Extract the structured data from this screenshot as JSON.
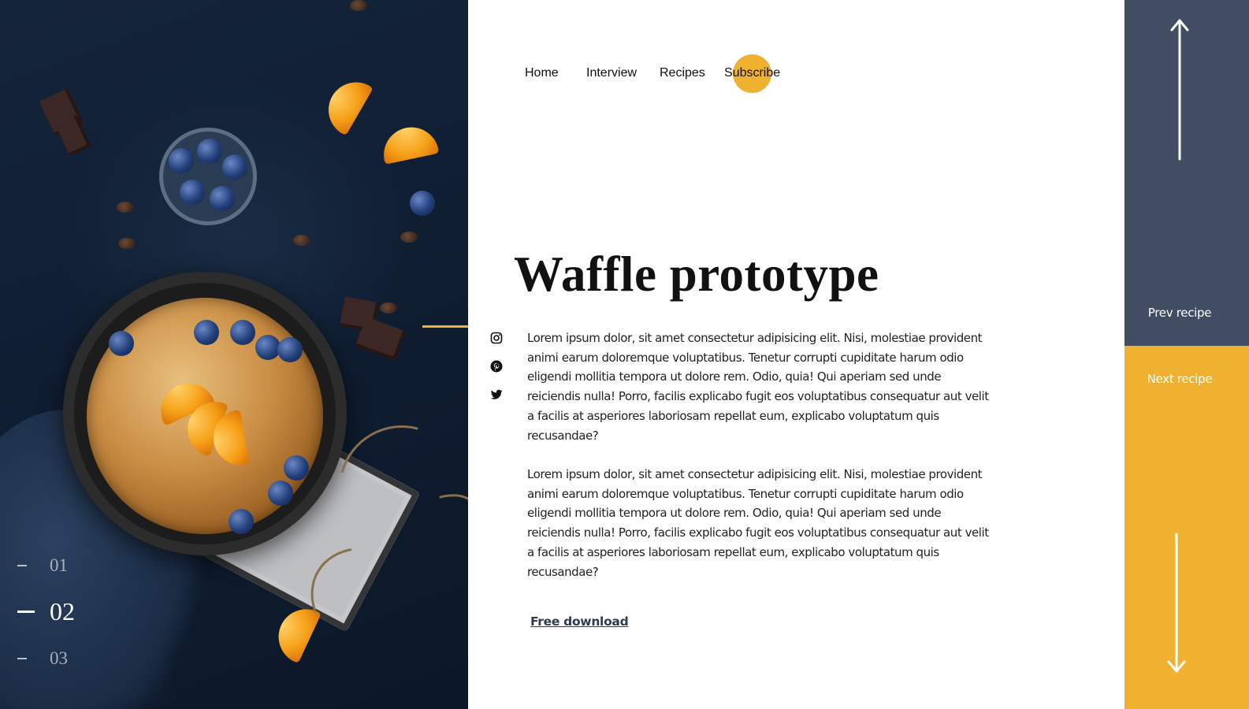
{
  "nav": {
    "home": "Home",
    "interview": "Interview",
    "recipes": "Recipes",
    "subscribe": "Subscribe"
  },
  "article": {
    "title": "Waffle prototype",
    "paragraph_1": "Lorem ipsum dolor, sit amet consectetur adipisicing elit. Nisi, molestiae provident animi earum doloremque voluptatibus. Tenetur corrupti cupiditate harum odio eligendi mollitia tempora ut dolore rem. Odio, quia! Qui aperiam sed unde reiciendis nulla! Porro, facilis explicabo fugit eos voluptatibus consequatur aut velit a facilis at asperiores laboriosam repellat eum, explicabo voluptatum quis recusandae?",
    "paragraph_2": "Lorem ipsum dolor, sit amet consectetur adipisicing elit. Nisi, molestiae provident animi earum doloremque voluptatibus. Tenetur corrupti cupiditate harum odio eligendi mollitia tempora ut dolore rem. Odio, quia! Qui aperiam sed unde reiciendis nulla! Porro, facilis explicabo fugit eos voluptatibus consequatur aut velit a facilis at asperiores laboriosam repellat eum, explicabo voluptatum quis recusandae?",
    "download_label": "Free download"
  },
  "social": [
    "instagram-icon",
    "pinterest-icon",
    "twitter-icon"
  ],
  "slides": {
    "items": [
      "01",
      "02",
      "03"
    ],
    "active": "02"
  },
  "side_nav": {
    "prev_label": "Prev recipe",
    "next_label": "Next recipe"
  },
  "colors": {
    "accent": "#f0b030",
    "slate": "#414d63",
    "text": "#111111",
    "link": "#2d3a55"
  }
}
